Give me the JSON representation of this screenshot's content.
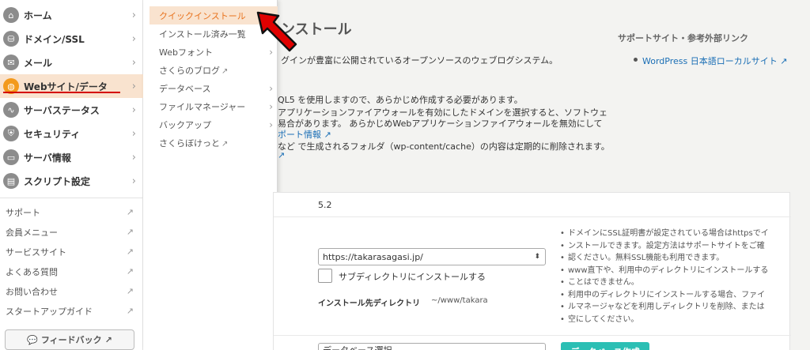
{
  "sidebar": {
    "nav": [
      {
        "label": "ホーム",
        "icon": "home-icon"
      },
      {
        "label": "ドメイン/SSL",
        "icon": "domain-icon"
      },
      {
        "label": "メール",
        "icon": "mail-icon"
      },
      {
        "label": "Webサイト/データ",
        "icon": "globe-icon",
        "active": true
      },
      {
        "label": "サーバステータス",
        "icon": "chart-icon"
      },
      {
        "label": "セキュリティ",
        "icon": "shield-icon"
      },
      {
        "label": "サーバ情報",
        "icon": "server-icon"
      },
      {
        "label": "スクリプト設定",
        "icon": "script-icon"
      }
    ],
    "links": [
      {
        "label": "サポート"
      },
      {
        "label": "会員メニュー"
      },
      {
        "label": "サービスサイト"
      },
      {
        "label": "よくある質問"
      },
      {
        "label": "お問い合わせ"
      },
      {
        "label": "スタートアップガイド"
      }
    ],
    "feedback_label": "フィードバック"
  },
  "submenu": {
    "items": [
      {
        "label": "クイックインストール",
        "active": true,
        "chevron": true
      },
      {
        "label": "インストール済み一覧",
        "chevron": false
      },
      {
        "label": "Webフォント",
        "chevron": true
      },
      {
        "label": "さくらのブログ",
        "external": true
      },
      {
        "label": "データベース",
        "chevron": true
      },
      {
        "label": "ファイルマネージャー",
        "chevron": true
      },
      {
        "label": "バックアップ",
        "chevron": true
      },
      {
        "label": "さくらぼけっと",
        "external": true
      }
    ]
  },
  "main": {
    "title": "ンストール",
    "description": "グインが豊富に公開されているオープンソースのウェブログシステム。",
    "requirements": [
      "QL5 を使用しますので、あらかじめ作成する必要があります。",
      "アプリケーションファイアウォールを有効にしたドメインを選択すると、ソフトウェ",
      "易合があります。 あらかじめWebアプリケーションファイアウォールを無効にして",
      "ポート情報",
      "など で生成されるフォルダ（wp-content/cache）の内容は定期的に削除されます。"
    ],
    "support_heading": "サポートサイト・参考外部リンク",
    "support_link": "WordPress 日本語ローカルサイト",
    "version": "5.2",
    "url_value": "https://takarasagasi.jp/",
    "subdir_label": "サブディレクトリにインストールする",
    "dir_label": "インストール先ディレクトリ",
    "dir_value": "~/www/takara",
    "notes": [
      "ドメインにSSL証明書が設定されている場合はhttpsでイ",
      "ンストールできます。設定方法はサポートサイトをご確",
      "認ください。無料SSL機能も利用できます。",
      "www直下や、利用中のディレクトリにインストールする",
      "ことはできません。",
      "利用中のディレクトリにインストールする場合、ファイ",
      "ルマネージャなどを利用しディレクトリを削除、または",
      "空にしてください。"
    ],
    "db_select": "データベース選択",
    "db_create": "データベース作成"
  },
  "colors": {
    "accent": "#f39a1d",
    "active_bg": "#f9e3cf",
    "link": "#1a6eb5",
    "annotation_red": "#d40000",
    "teal_button": "#2bbfb4"
  }
}
